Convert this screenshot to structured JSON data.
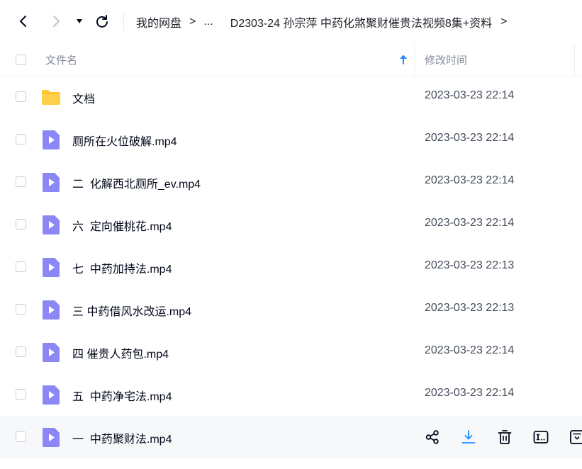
{
  "toolbar": {
    "back_icon": "chevron-left-icon",
    "forward_icon": "chevron-right-icon",
    "history_icon": "caret-down-icon",
    "refresh_icon": "refresh-icon"
  },
  "breadcrumb": {
    "root": "我的网盘",
    "ellipsis": "...",
    "current": "D2303-24 孙宗萍 中药化煞聚财催贵法视频8集+资料",
    "separator": ">"
  },
  "header": {
    "name_label": "文件名",
    "time_label": "修改时间",
    "sort_icon": "arrow-up-icon"
  },
  "colors": {
    "folder": "#ffc634",
    "video": "#8b88f6",
    "accent": "#1e8cff"
  },
  "files": [
    {
      "type": "folder",
      "icon": "folder-icon",
      "name": "文档",
      "modified": "2023-03-23 22:14"
    },
    {
      "type": "video",
      "icon": "video-file-icon",
      "name": "厕所在火位破解.mp4",
      "modified": "2023-03-23 22:14"
    },
    {
      "type": "video",
      "icon": "video-file-icon",
      "name": "二  化解西北厕所_ev.mp4",
      "modified": "2023-03-23 22:14"
    },
    {
      "type": "video",
      "icon": "video-file-icon",
      "name": "六  定向催桃花.mp4",
      "modified": "2023-03-23 22:14"
    },
    {
      "type": "video",
      "icon": "video-file-icon",
      "name": "七  中药加持法.mp4",
      "modified": "2023-03-23 22:13"
    },
    {
      "type": "video",
      "icon": "video-file-icon",
      "name": "三 中药借风水改运.mp4",
      "modified": "2023-03-23 22:13"
    },
    {
      "type": "video",
      "icon": "video-file-icon",
      "name": "四 催贵人药包.mp4",
      "modified": "2023-03-23 22:14"
    },
    {
      "type": "video",
      "icon": "video-file-icon",
      "name": "五  中药净宅法.mp4",
      "modified": "2023-03-23 22:14"
    },
    {
      "type": "video",
      "icon": "video-file-icon",
      "name": "一  中药聚财法.mp4",
      "modified": "",
      "hovered": true
    }
  ],
  "row_actions": [
    "share-icon",
    "download-icon",
    "delete-icon",
    "rename-icon",
    "more-file-icon"
  ]
}
